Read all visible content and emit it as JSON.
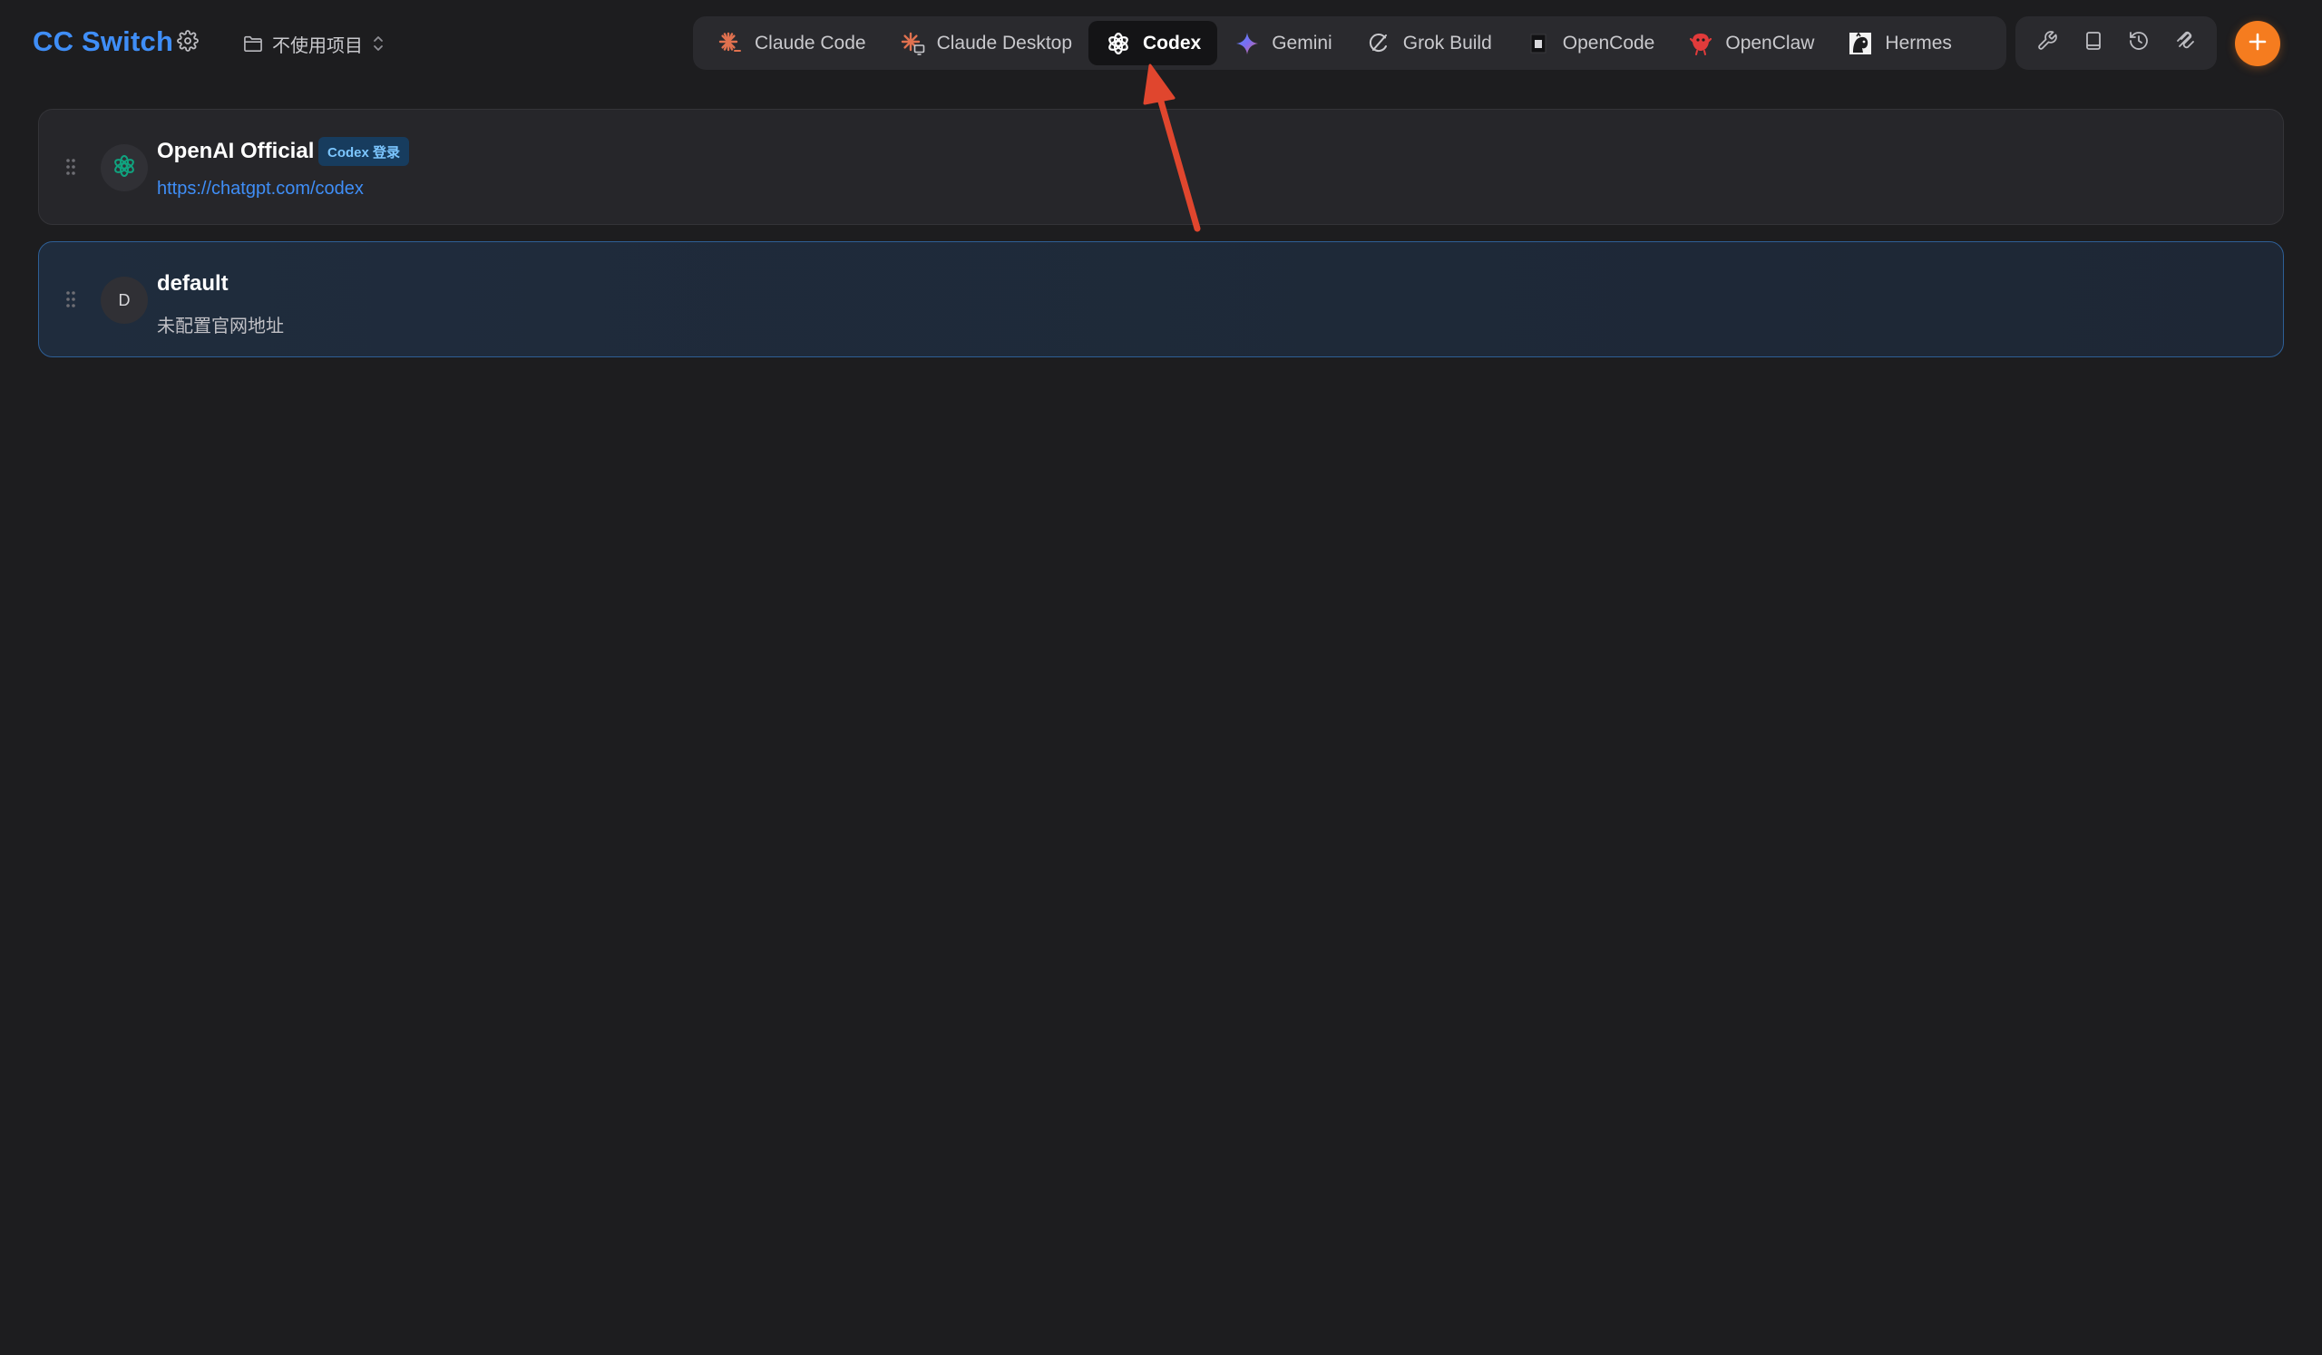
{
  "app": {
    "title": "CC Switch"
  },
  "project": {
    "label": "不使用项目"
  },
  "tabs": [
    {
      "label": "Claude Code",
      "icon": "claude-code-icon"
    },
    {
      "label": "Claude Desktop",
      "icon": "claude-desktop-icon"
    },
    {
      "label": "Codex",
      "icon": "codex-icon",
      "active": true
    },
    {
      "label": "Gemini",
      "icon": "gemini-icon"
    },
    {
      "label": "Grok Build",
      "icon": "grok-icon"
    },
    {
      "label": "OpenCode",
      "icon": "opencode-icon"
    },
    {
      "label": "OpenClaw",
      "icon": "openclaw-icon"
    },
    {
      "label": "Hermes",
      "icon": "hermes-icon"
    }
  ],
  "tools": [
    "wrench-icon",
    "book-icon",
    "history-icon",
    "mcp-icon"
  ],
  "providers": [
    {
      "name": "OpenAI Official",
      "badge": "Codex 登录",
      "url": "https://chatgpt.com/codex",
      "avatar_icon": "openai-icon"
    },
    {
      "name": "default",
      "avatar_letter": "D",
      "subtitle": "未配置官网地址",
      "selected": true
    }
  ],
  "colors": {
    "background": "#1d1d1f",
    "brand": "#3f8ef7",
    "accent_orange": "#f57c1f",
    "selected_border": "#2e5f96",
    "annotation_arrow": "#e0462e"
  }
}
